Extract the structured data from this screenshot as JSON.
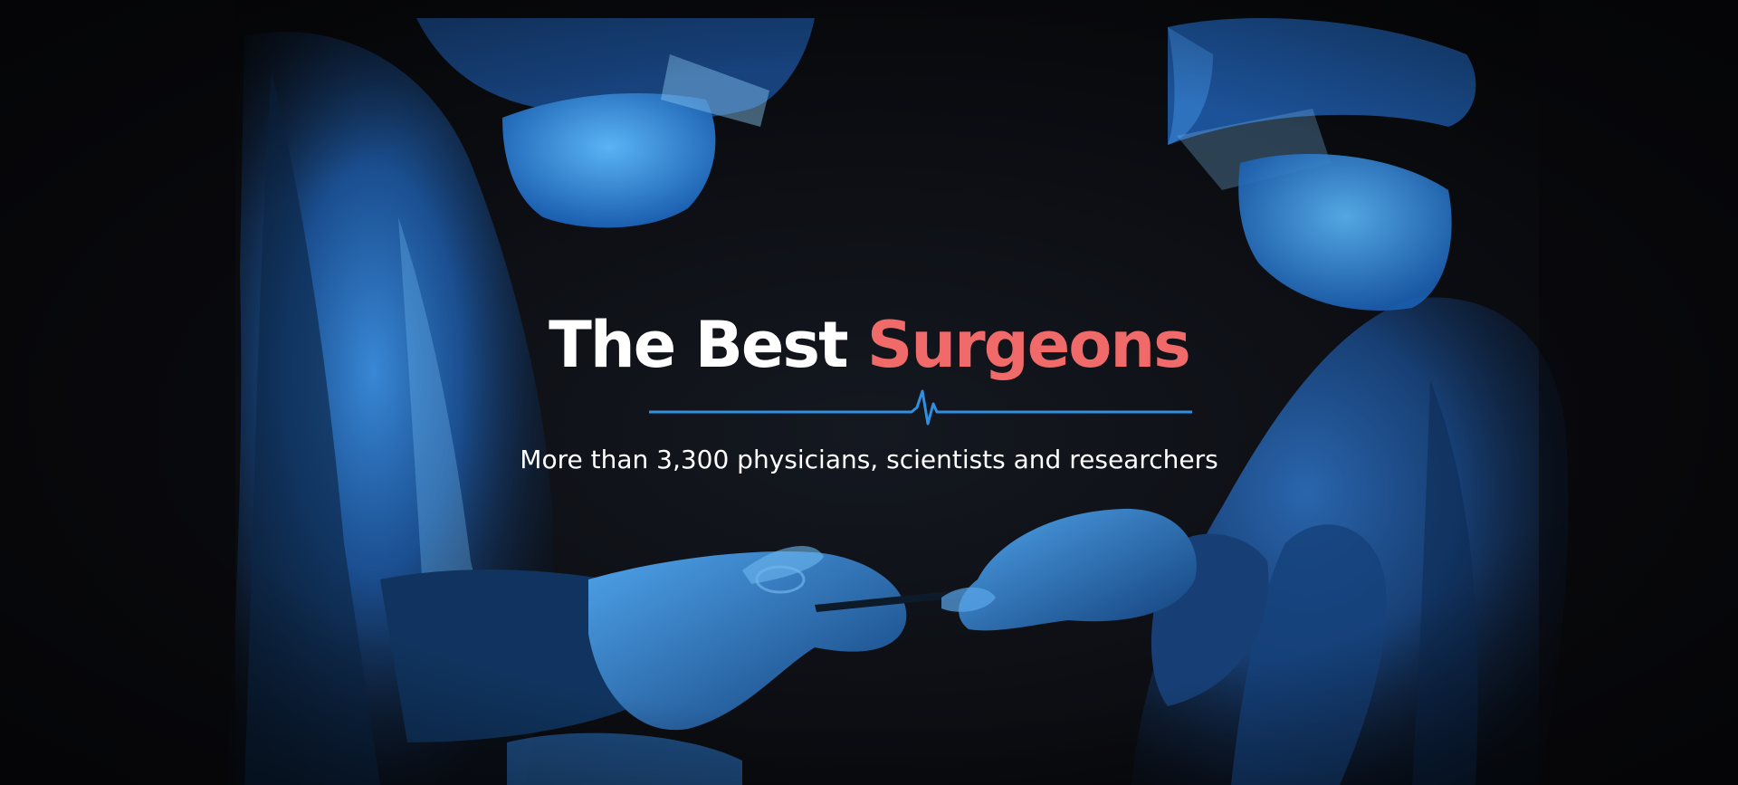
{
  "hero": {
    "title_main": "The Best",
    "title_accent": "Surgeons",
    "subtitle": "More than 3,300 physicians, scientists and researchers",
    "colors": {
      "background": "#0b0c10",
      "title": "#ffffff",
      "accent": "#f16a6a",
      "divider": "#2f8fe0",
      "scrubs": "#1f64b8"
    },
    "divider_icon": "heartbeat-line-icon"
  }
}
